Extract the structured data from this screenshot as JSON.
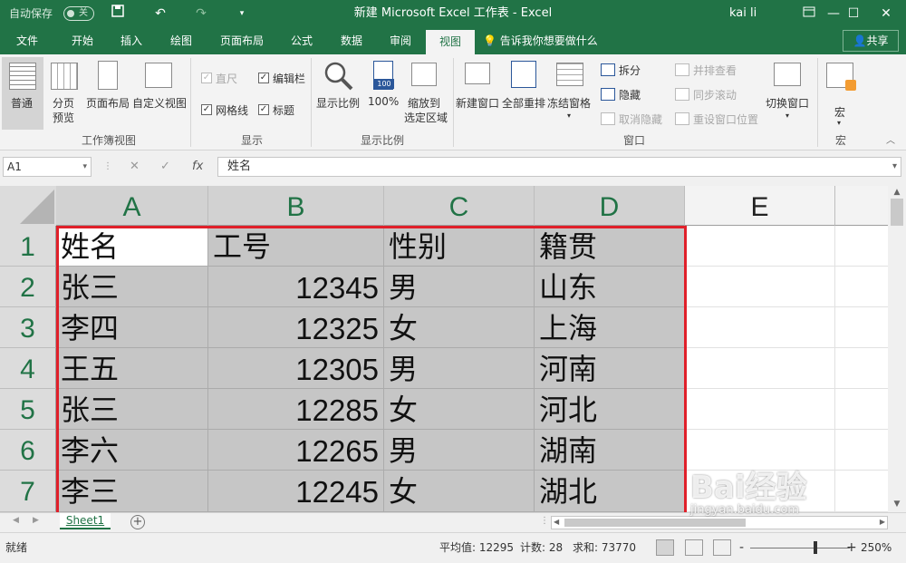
{
  "titlebar": {
    "autosave_label": "自动保存",
    "autosave_state": "关",
    "doc_title": "新建 Microsoft Excel 工作表 - Excel",
    "user": "kai li"
  },
  "tabs": [
    "文件",
    "开始",
    "插入",
    "绘图",
    "页面布局",
    "公式",
    "数据",
    "审阅",
    "视图"
  ],
  "active_tab": "视图",
  "tell_me": "告诉我你想要做什么",
  "share": "共享",
  "ribbon": {
    "workbook_views": {
      "label": "工作簿视图",
      "normal": "普通",
      "page_break_1": "分页",
      "page_break_2": "预览",
      "page_layout": "页面布局",
      "custom": "自定义视图"
    },
    "show": {
      "label": "显示",
      "ruler": "直尺",
      "formula_bar": "编辑栏",
      "gridlines": "网格线",
      "headings": "标题"
    },
    "zoom": {
      "label": "显示比例",
      "zoom": "显示比例",
      "hundred": "100%",
      "hundred_icon": "100",
      "zoom_sel_1": "缩放到",
      "zoom_sel_2": "选定区域"
    },
    "window": {
      "label": "窗口",
      "new_window": "新建窗口",
      "arrange_all": "全部重排",
      "freeze": "冻结窗格",
      "split": "拆分",
      "hide": "隐藏",
      "unhide": "取消隐藏",
      "side_by_side": "并排查看",
      "sync_scroll": "同步滚动",
      "reset_pos": "重设窗口位置",
      "switch": "切换窗口"
    },
    "macros": {
      "label": "宏",
      "macros": "宏"
    }
  },
  "formula_bar": {
    "name_box": "A1",
    "cancel": "✕",
    "enter": "✓",
    "fx": "fx",
    "content": "姓名"
  },
  "columns": [
    "A",
    "B",
    "C",
    "D",
    "E"
  ],
  "rows": [
    "1",
    "2",
    "3",
    "4",
    "5",
    "6",
    "7"
  ],
  "cells": [
    [
      "姓名",
      "工号",
      "性别",
      "籍贯"
    ],
    [
      "张三",
      "12345",
      "男",
      "山东"
    ],
    [
      "李四",
      "12325",
      "女",
      "上海"
    ],
    [
      "王五",
      "12305",
      "男",
      "河南"
    ],
    [
      "张三",
      "12285",
      "女",
      "河北"
    ],
    [
      "李六",
      "12265",
      "男",
      "湖南"
    ],
    [
      "李三",
      "12245",
      "女",
      "湖北"
    ]
  ],
  "sheet_tab": "Sheet1",
  "status": {
    "ready": "就绪",
    "average": "平均值: 12295",
    "count": "计数: 28",
    "sum": "求和: 73770",
    "zoom_minus": "-",
    "zoom_plus": "+",
    "zoom": "250%"
  },
  "watermark": {
    "brand": "Bai经验",
    "url": "jingyan.baidu.com"
  },
  "colors": {
    "excel_green": "#217346",
    "selection_red": "#e0202a"
  }
}
